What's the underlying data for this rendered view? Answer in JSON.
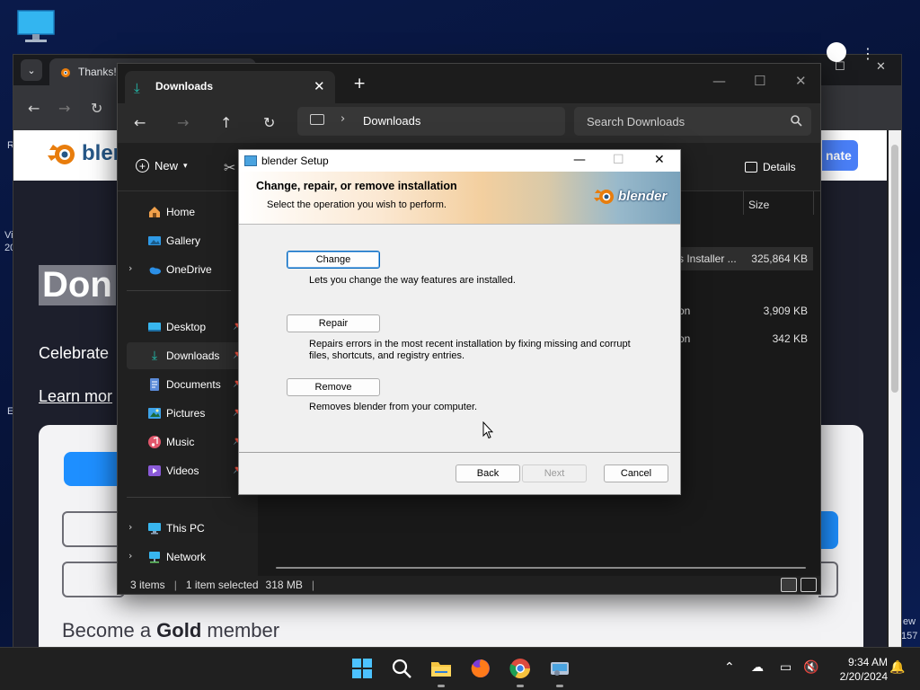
{
  "desktop": {
    "left_cut_1": "R",
    "left_cut_2": "Vi",
    "left_cut_3": "20",
    "left_cut_4": "E",
    "right_cut_1": "ew",
    "right_cut_2": "157"
  },
  "browser": {
    "tab_title": "Thanks!",
    "page": {
      "logo_text": "blen",
      "donate_label": "nate",
      "heading": "Don",
      "celebrate_text": "Celebrate",
      "learn_more": "Learn mor",
      "gold_prefix": "Become a ",
      "gold_bold": "Gold",
      "gold_suffix": " member"
    }
  },
  "explorer": {
    "tab_title": "Downloads",
    "address": "Downloads",
    "search_placeholder": "Search Downloads",
    "new_label": "New",
    "details_label": "Details",
    "nav_items": [
      {
        "label": "Home",
        "icon": "home-icon"
      },
      {
        "label": "Gallery",
        "icon": "gallery-icon"
      },
      {
        "label": "OneDrive",
        "icon": "cloud-icon"
      },
      {
        "label": "Desktop",
        "icon": "desktop-icon"
      },
      {
        "label": "Downloads",
        "icon": "download-icon"
      },
      {
        "label": "Documents",
        "icon": "document-icon"
      },
      {
        "label": "Pictures",
        "icon": "pictures-icon"
      },
      {
        "label": "Music",
        "icon": "music-icon"
      },
      {
        "label": "Videos",
        "icon": "videos-icon"
      },
      {
        "label": "This PC",
        "icon": "computer-icon"
      },
      {
        "label": "Network",
        "icon": "network-icon"
      }
    ],
    "columns": {
      "size": "Size"
    },
    "files": [
      {
        "type": "s Installer ...",
        "size": "325,864 KB"
      },
      {
        "type": "on",
        "size": "3,909 KB"
      },
      {
        "type": "on",
        "size": "342 KB"
      }
    ],
    "status": {
      "items": "3 items",
      "selected": "1 item selected",
      "selected_size": "318 MB"
    }
  },
  "setup": {
    "title": "blender Setup",
    "heading": "Change, repair, or remove installation",
    "subheading": "Select the operation you wish to perform.",
    "logo_text": "blender",
    "options": [
      {
        "label": "Change",
        "desc": "Lets you change the way features are installed."
      },
      {
        "label": "Repair",
        "desc": "Repairs errors in the most recent installation by fixing missing and corrupt files, shortcuts, and registry entries."
      },
      {
        "label": "Remove",
        "desc": "Removes blender from your computer."
      }
    ],
    "back_label": "Back",
    "next_label": "Next",
    "cancel_label": "Cancel"
  },
  "taskbar": {
    "time": "9:34 AM",
    "date": "2/20/2024"
  },
  "colors": {
    "blender_orange": "#e87d0d",
    "blender_blue": "#265787",
    "accent_blue": "#0067c0",
    "downloads_teal": "#22c0b0"
  }
}
